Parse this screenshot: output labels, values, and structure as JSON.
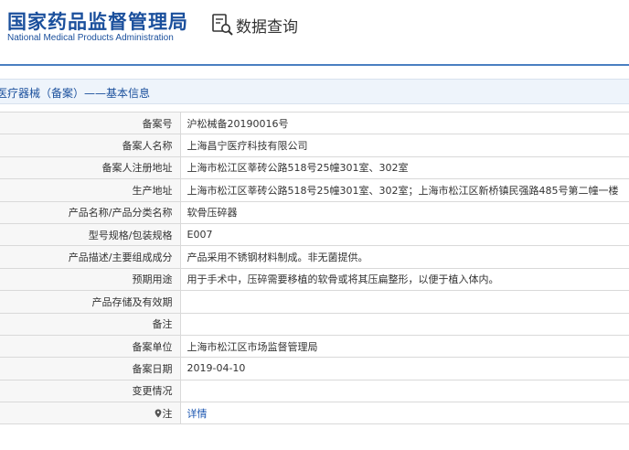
{
  "header": {
    "brand_cn": "国家药品监督管理局",
    "brand_en": "National Medical Products Administration",
    "query_label": "数据查询",
    "query_icon": "search-document-icon",
    "brand_color": "#1a4f9c"
  },
  "section": {
    "title": "医疗器械（备案）——基本信息"
  },
  "rows": [
    {
      "label": "备案号",
      "value": "沪松械备20190016号"
    },
    {
      "label": "备案人名称",
      "value": "上海昌宁医疗科技有限公司"
    },
    {
      "label": "备案人注册地址",
      "value": "上海市松江区莘砖公路518号25幢301室、302室"
    },
    {
      "label": "生产地址",
      "value": "上海市松江区莘砖公路518号25幢301室、302室；上海市松江区新桥镇民强路485号第二幢一楼"
    },
    {
      "label": "产品名称/产品分类名称",
      "value": "软骨压碎器"
    },
    {
      "label": "型号规格/包装规格",
      "value": "E007"
    },
    {
      "label": "产品描述/主要组成成分",
      "value": "产品采用不锈钢材料制成。非无菌提供。"
    },
    {
      "label": "预期用途",
      "value": "用于手术中，压碎需要移植的软骨或将其压扁整形，以便于植入体内。"
    },
    {
      "label": "产品存储及有效期",
      "value": ""
    },
    {
      "label": "备注",
      "value": ""
    },
    {
      "label": "备案单位",
      "value": "上海市松江区市场监督管理局"
    },
    {
      "label": "备案日期",
      "value": "2019-04-10"
    },
    {
      "label": "变更情况",
      "value": ""
    }
  ],
  "note_row": {
    "label": "注",
    "link": "详情",
    "icon": "location-pin-icon"
  }
}
